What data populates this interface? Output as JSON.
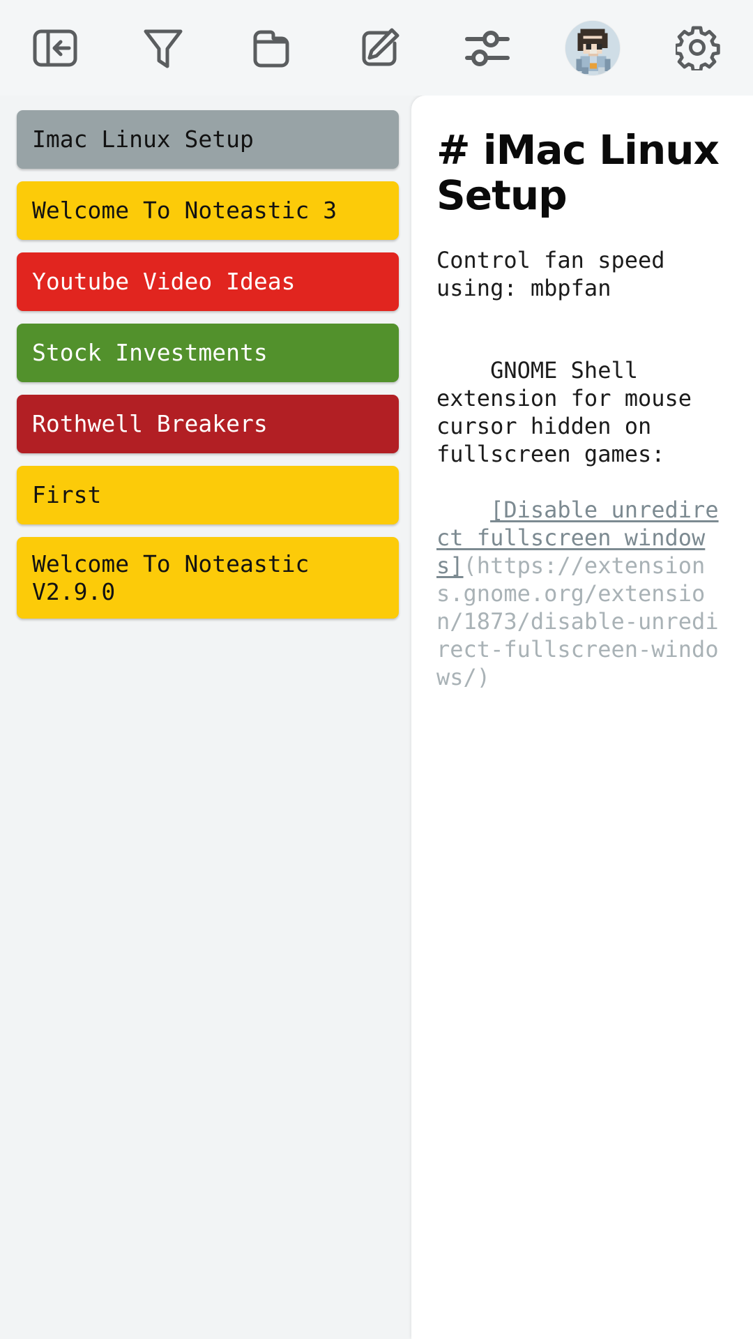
{
  "toolbar": {
    "items": [
      {
        "name": "collapse-sidebar-icon",
        "label": "Collapse sidebar"
      },
      {
        "name": "filter-icon",
        "label": "Filter notes"
      },
      {
        "name": "folder-icon",
        "label": "Folders"
      },
      {
        "name": "new-note-icon",
        "label": "New note"
      },
      {
        "name": "sliders-icon",
        "label": "Sort and options"
      },
      {
        "name": "avatar",
        "label": "Account"
      },
      {
        "name": "gear-icon",
        "label": "Settings"
      }
    ]
  },
  "sidebar": {
    "notes": [
      {
        "title": "Imac Linux Setup",
        "bg": "#98a3a6",
        "fg": "#121212",
        "selected": true
      },
      {
        "title": "Welcome To Noteastic 3",
        "bg": "#fccb09",
        "fg": "#121212",
        "selected": false
      },
      {
        "title": "Youtube Video Ideas",
        "bg": "#e1251f",
        "fg": "#ffffff",
        "selected": false
      },
      {
        "title": "Stock Investments",
        "bg": "#52912c",
        "fg": "#ffffff",
        "selected": false
      },
      {
        "title": "Rothwell Breakers",
        "bg": "#b21f24",
        "fg": "#ffffff",
        "selected": false
      },
      {
        "title": "First",
        "bg": "#fccb09",
        "fg": "#121212",
        "selected": false
      },
      {
        "title": "Welcome To Noteastic V2.9.0",
        "bg": "#fccb09",
        "fg": "#121212",
        "selected": false
      }
    ]
  },
  "editor": {
    "title": "# iMac Linux Setup",
    "paragraph_1": "Control fan speed using: mbpfan",
    "paragraph_2_text": "GNOME Shell extension for mouse cursor hidden on fullscreen games:",
    "link_label": "[Disable unredirect fullscreen windows]",
    "link_url": "(https://extensions.gnome.org/extension/1873/disable-unredirect-fullscreen-windows/)"
  },
  "colors": {
    "toolbar_bg": "#f4f6f7",
    "sidebar_bg": "#f2f4f5",
    "editor_bg": "#ffffff",
    "icon_stroke": "#5a5d5f",
    "link": "#7c8a91",
    "url": "#a9b2b6"
  }
}
